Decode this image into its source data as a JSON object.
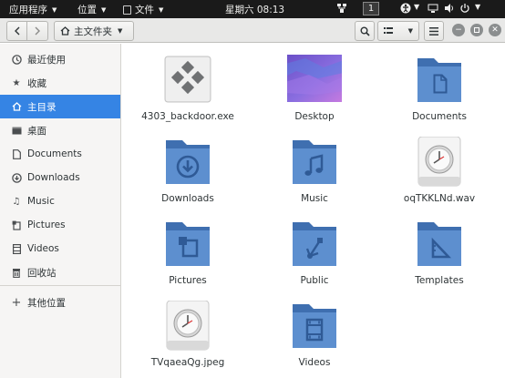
{
  "topbar": {
    "apps_menu": "应用程序",
    "places_menu": "位置",
    "files_menu": "文件",
    "clock": "星期六 08:13",
    "workspace": "1"
  },
  "headerbar": {
    "path_label": "主文件夹"
  },
  "sidebar": {
    "items": [
      {
        "label": "最近使用",
        "icon": "clock-icon"
      },
      {
        "label": "收藏",
        "icon": "star-icon"
      },
      {
        "label": "主目录",
        "icon": "home-icon"
      },
      {
        "label": "桌面",
        "icon": "desktop-icon"
      },
      {
        "label": "Documents",
        "icon": "document-icon"
      },
      {
        "label": "Downloads",
        "icon": "download-icon"
      },
      {
        "label": "Music",
        "icon": "music-icon"
      },
      {
        "label": "Pictures",
        "icon": "pictures-icon"
      },
      {
        "label": "Videos",
        "icon": "videos-icon"
      },
      {
        "label": "回收站",
        "icon": "trash-icon"
      },
      {
        "label": "其他位置",
        "icon": "plus-icon"
      }
    ]
  },
  "files": [
    {
      "name": "4303_backdoor.exe",
      "icon": "executable-icon"
    },
    {
      "name": "Desktop",
      "icon": "desktop-folder-icon"
    },
    {
      "name": "Documents",
      "icon": "documents-folder-icon"
    },
    {
      "name": "Downloads",
      "icon": "downloads-folder-icon"
    },
    {
      "name": "Music",
      "icon": "music-folder-icon"
    },
    {
      "name": "oqTKKLNd.wav",
      "icon": "unknown-file-icon"
    },
    {
      "name": "Pictures",
      "icon": "pictures-folder-icon"
    },
    {
      "name": "Public",
      "icon": "public-folder-icon"
    },
    {
      "name": "Templates",
      "icon": "templates-folder-icon"
    },
    {
      "name": "TVqaeaQg.jpeg",
      "icon": "unknown-file-icon"
    },
    {
      "name": "Videos",
      "icon": "videos-folder-icon"
    }
  ],
  "colors": {
    "accent": "#3584e4",
    "folder": "#5d8fcf",
    "topbar": "#1a1a1a"
  }
}
